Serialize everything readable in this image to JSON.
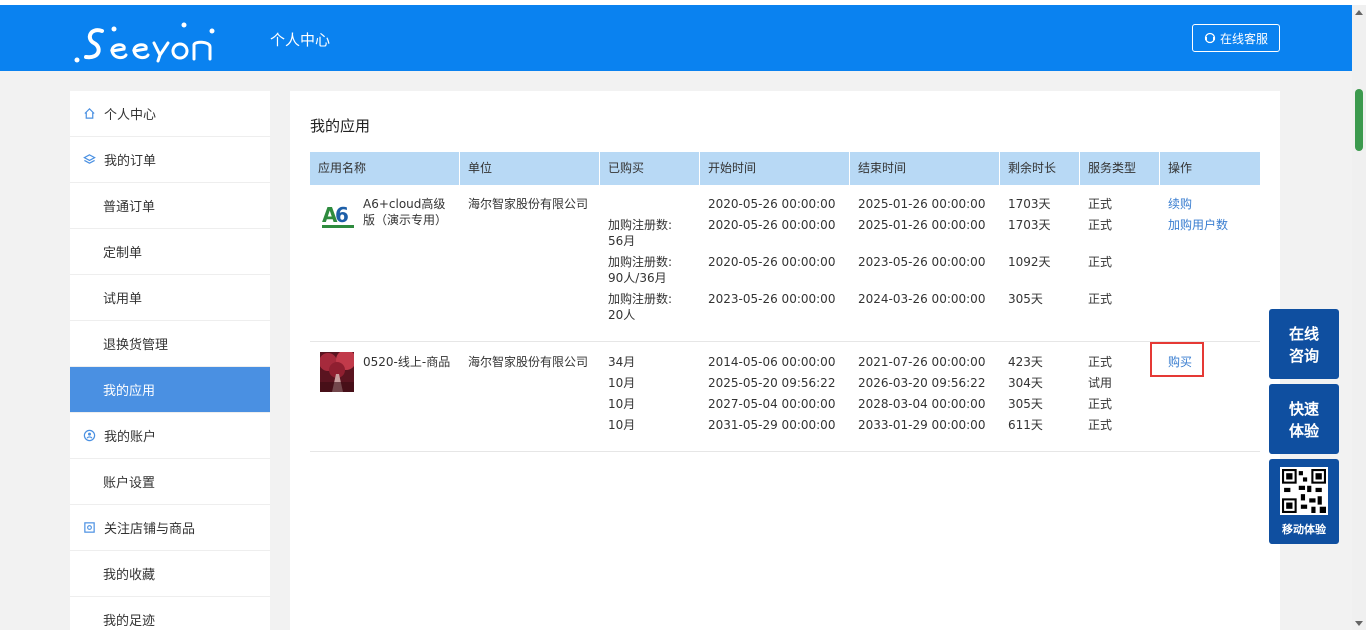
{
  "header": {
    "brand": "Seeyon",
    "title": "个人中心",
    "service_button": "在线客服"
  },
  "sidebar": {
    "items": [
      {
        "label": "个人中心",
        "type": "head",
        "icon": "home-icon"
      },
      {
        "label": "我的订单",
        "type": "head",
        "icon": "layers-icon"
      },
      {
        "label": "普通订单",
        "type": "sub"
      },
      {
        "label": "定制单",
        "type": "sub"
      },
      {
        "label": "试用单",
        "type": "sub"
      },
      {
        "label": "退换货管理",
        "type": "sub"
      },
      {
        "label": "我的应用",
        "type": "sub",
        "active": true
      },
      {
        "label": "我的账户",
        "type": "head",
        "icon": "account-icon"
      },
      {
        "label": "账户设置",
        "type": "sub"
      },
      {
        "label": "关注店铺与商品",
        "type": "head",
        "icon": "store-icon"
      },
      {
        "label": "我的收藏",
        "type": "sub"
      },
      {
        "label": "我的足迹",
        "type": "sub"
      }
    ]
  },
  "main": {
    "title": "我的应用",
    "columns": [
      "应用名称",
      "单位",
      "已购买",
      "开始时间",
      "结束时间",
      "剩余时长",
      "服务类型",
      "操作"
    ],
    "apps": [
      {
        "name": "A6+cloud高级版（演示专用）",
        "name_line1": "A6+cloud高级",
        "name_line2": "版（演示专用）",
        "unit": "海尔智家股份有限公司",
        "rows": [
          {
            "purchased": "",
            "start": "2020-05-26 00:00:00",
            "end": "2025-01-26 00:00:00",
            "remaining": "1703天",
            "type": "正式",
            "action": "续购"
          },
          {
            "purchased": "加购注册数:",
            "purchased2": "56月",
            "start": "2020-05-26 00:00:00",
            "end": "2025-01-26 00:00:00",
            "remaining": "1703天",
            "type": "正式",
            "action": "加购用户数"
          },
          {
            "purchased": "加购注册数:",
            "purchased2": "90人/36月",
            "start": "2020-05-26 00:00:00",
            "end": "2023-05-26 00:00:00",
            "remaining": "1092天",
            "type": "正式",
            "action": ""
          },
          {
            "purchased": "加购注册数:",
            "purchased2": "20人",
            "start": "2023-05-26 00:00:00",
            "end": "2024-03-26 00:00:00",
            "remaining": "305天",
            "type": "正式",
            "action": ""
          }
        ]
      },
      {
        "name": "0520-线上-商品",
        "unit": "海尔智家股份有限公司",
        "rows": [
          {
            "purchased": "34月",
            "start": "2014-05-06 00:00:00",
            "end": "2021-07-26 00:00:00",
            "remaining": "423天",
            "type": "正式",
            "action": "购买"
          },
          {
            "purchased": "10月",
            "start": "2025-05-20 09:56:22",
            "end": "2026-03-20 09:56:22",
            "remaining": "304天",
            "type": "试用",
            "action": ""
          },
          {
            "purchased": "10月",
            "start": "2027-05-04 00:00:00",
            "end": "2028-03-04 00:00:00",
            "remaining": "305天",
            "type": "正式",
            "action": ""
          },
          {
            "purchased": "10月",
            "start": "2031-05-29 00:00:00",
            "end": "2033-01-29 00:00:00",
            "remaining": "611天",
            "type": "正式",
            "action": ""
          }
        ]
      }
    ]
  },
  "float": {
    "consult_line1": "在线",
    "consult_line2": "咨询",
    "trial_line1": "快速",
    "trial_line2": "体验",
    "mobile": "移动体验"
  },
  "colors": {
    "header_bg": "#0a82f0",
    "table_head": "#b8d9f5",
    "active_item": "#4a90e2",
    "float_btn": "#0f4fa0",
    "link": "#3a7ed0",
    "highlight": "#e53935"
  }
}
